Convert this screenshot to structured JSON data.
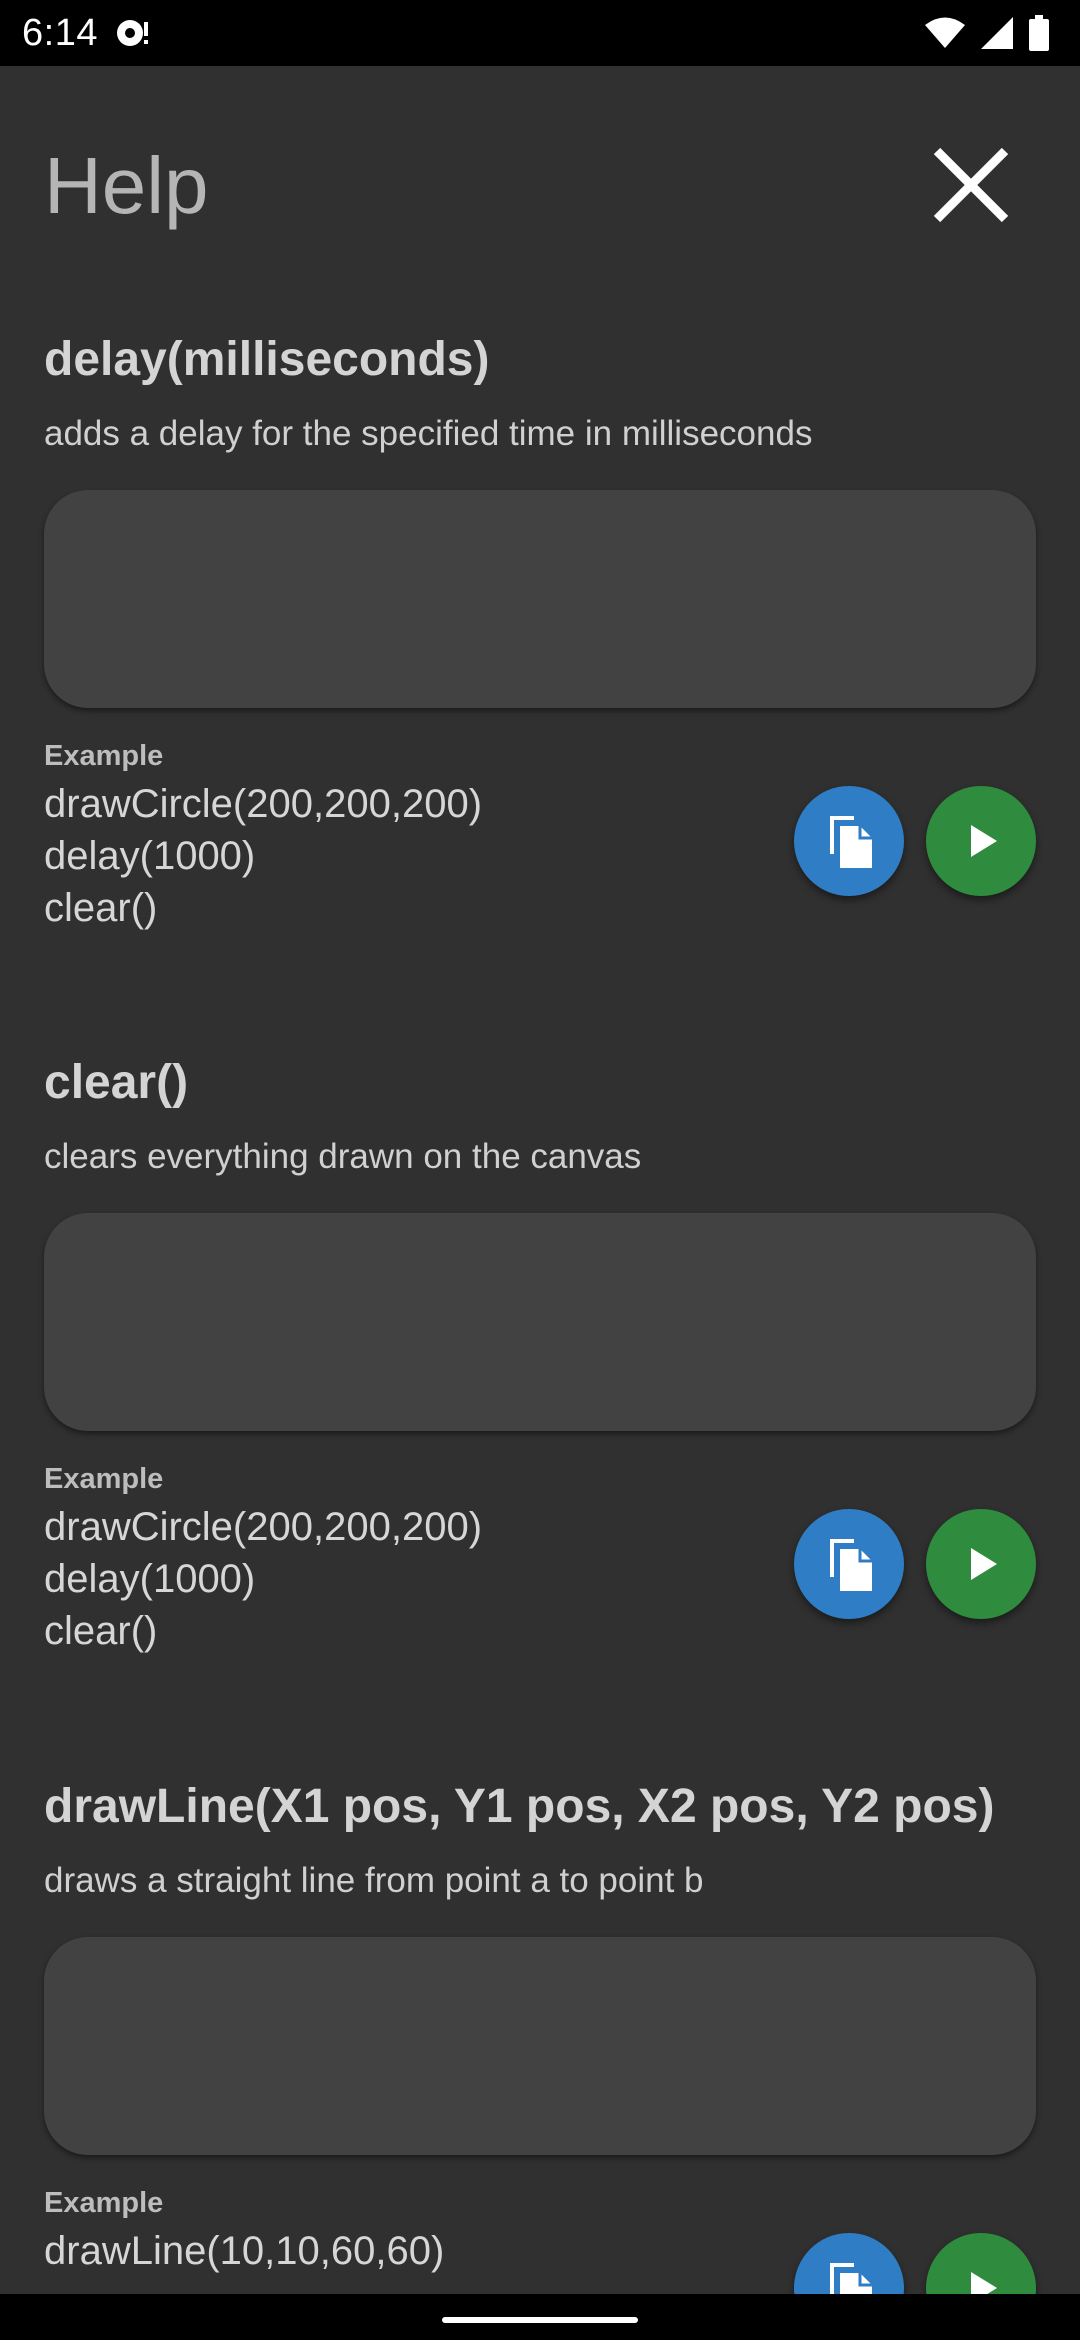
{
  "status_bar": {
    "time": "6:14",
    "left_icon": "notification-app-icon",
    "right_icons": [
      "wifi-icon",
      "signal-icon",
      "battery-icon"
    ]
  },
  "header": {
    "title": "Help",
    "close_icon": "close-icon"
  },
  "sections": [
    {
      "title": "delay(milliseconds)",
      "description": "adds a delay for the specified time in milliseconds",
      "example_label": "Example",
      "example_code": "drawCircle(200,200,200)\ndelay(1000)\nclear()"
    },
    {
      "title": "clear()",
      "description": "clears everything drawn on the canvas",
      "example_label": "Example",
      "example_code": "drawCircle(200,200,200)\ndelay(1000)\nclear()"
    },
    {
      "title": "drawLine(X1 pos, Y1 pos, X2 pos, Y2 pos)",
      "description": "draws a straight line from point a to point b",
      "example_label": "Example",
      "example_code": "drawLine(10,10,60,60)"
    }
  ],
  "colors": {
    "background": "#303030",
    "canvas": "#424242",
    "copy_button": "#2f7ec5",
    "run_button": "#2f8c3e"
  }
}
